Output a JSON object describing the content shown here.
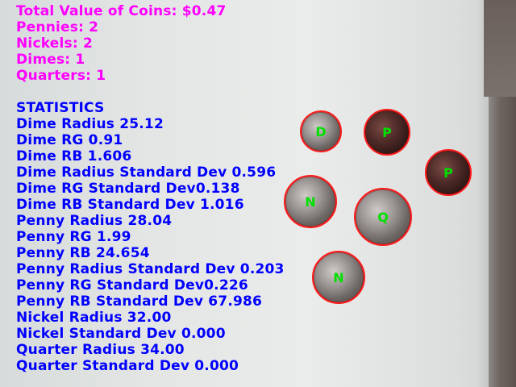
{
  "summary": {
    "total": "Total Value of Coins: $0.47",
    "pennies": "Pennies: 2",
    "nickels": "Nickels: 2",
    "dimes": "Dimes: 1",
    "quarters": "Quarters: 1"
  },
  "statistics": {
    "heading": "STATISTICS",
    "lines": [
      "Dime Radius 25.12",
      "Dime RG 0.91",
      "Dime RB 1.606",
      "Dime Radius Standard Dev 0.596",
      "Dime RG Standard Dev0.138",
      "Dime RB Standard Dev 1.016",
      "Penny Radius 28.04",
      "Penny RG 1.99",
      "Penny RB 24.654",
      "Penny Radius Standard Dev 0.203",
      "Penny RG Standard Dev0.226",
      "Penny RB Standard Dev 67.986",
      "Nickel Radius 32.00",
      "Nickel Standard Dev 0.000",
      "Quarter Radius 34.00",
      "Quarter Standard Dev 0.000"
    ]
  },
  "colors": {
    "summary_text": "#ff00ff",
    "statistics_text": "#0000ff",
    "coin_outline": "#ff1a1a",
    "coin_label": "#00e000"
  },
  "coins": [
    {
      "label": "D"
    },
    {
      "label": "P"
    },
    {
      "label": "P"
    },
    {
      "label": "N"
    },
    {
      "label": "Q"
    },
    {
      "label": "N"
    }
  ]
}
